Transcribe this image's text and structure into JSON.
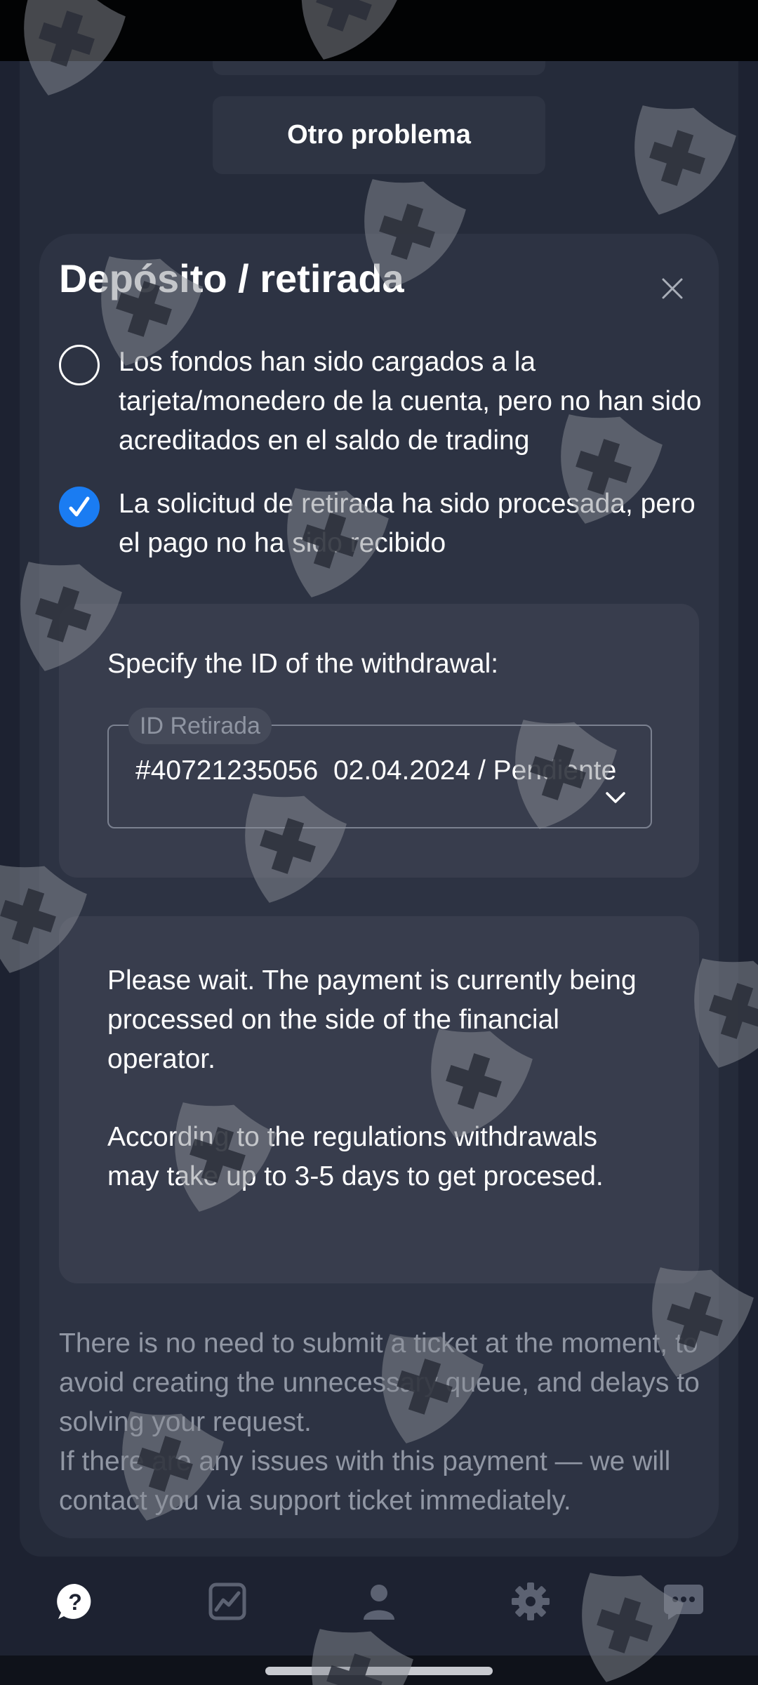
{
  "previous_list": {
    "other_problem_label": "Otro problema"
  },
  "card": {
    "title": "Depósito / retirada",
    "close_icon": "close-icon",
    "options": [
      {
        "label": "Los fondos han sido cargados a la tarjeta/monedero de la cuenta, pero no han sido acreditados en el saldo de trading",
        "selected": false
      },
      {
        "label": "La solicitud de retirada ha sido procesada, pero el pago no ha sido recibido",
        "selected": true
      }
    ],
    "withdrawal": {
      "prompt": "Specify the ID of the withdrawal:",
      "field_label": "ID Retirada",
      "selected_value": "#40721235056  02.04.2024 / Pendiente"
    },
    "info": {
      "paragraph1": "Please wait. The payment is currently being processed on the side of the financial operator.",
      "paragraph2": "According to the regulations withdrawals may take up to 3-5 days to get procesed."
    },
    "note": {
      "line1": "There is no need to submit a ticket at the moment, to avoid creating the unnecessary queue, and delays to solving your request.",
      "line2": "If there are any issues with this payment — we will contact you via support ticket immediately."
    }
  },
  "bottom_nav": {
    "items": [
      {
        "icon": "help-icon",
        "active": true
      },
      {
        "icon": "chart-icon",
        "active": false
      },
      {
        "icon": "profile-icon",
        "active": false
      },
      {
        "icon": "settings-icon",
        "active": false
      },
      {
        "icon": "chat-icon",
        "active": false
      }
    ]
  },
  "colors": {
    "background": "#1d2231",
    "card": "#2d3343",
    "inner_card": "#383d4d",
    "accent": "#1a7cf2",
    "muted_text": "#9197a4"
  }
}
